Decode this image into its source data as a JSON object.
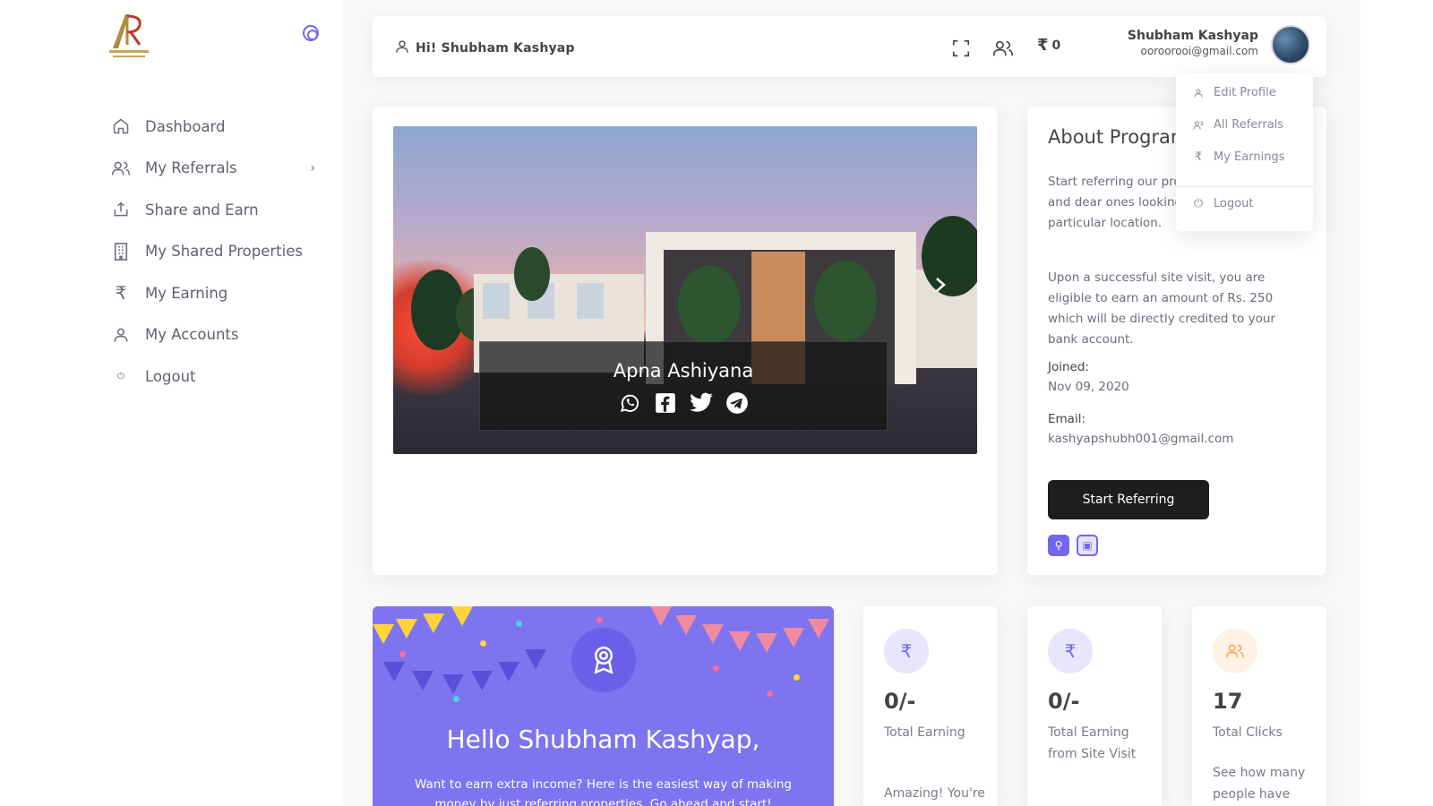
{
  "sidebar": {
    "items": [
      {
        "label": "Dashboard",
        "icon": "home-icon"
      },
      {
        "label": "My Referrals",
        "icon": "users-icon"
      },
      {
        "label": "Share and Earn",
        "icon": "share-icon"
      },
      {
        "label": "My Shared Properties",
        "icon": "building-icon"
      },
      {
        "label": "My Earning",
        "icon": "rupee-icon"
      },
      {
        "label": "My Accounts",
        "icon": "user-icon"
      },
      {
        "label": "Logout",
        "icon": "power-icon"
      }
    ]
  },
  "topbar": {
    "greeting": "Hi! Shubham Kashyap",
    "rupee_count": "0",
    "user_name": "Shubham Kashyap",
    "user_email": "ooroorooi@gmail.com"
  },
  "user_menu": {
    "items": [
      "Edit Profile",
      "All Referrals",
      "My Earnings",
      "Logout"
    ]
  },
  "banner": {
    "title": "Apna Ashiyana"
  },
  "about": {
    "title": "About Program",
    "para1": "Start referring our properties to your near and dear ones looking for property in a particular location.",
    "para2": "Upon a successful site visit, you are eligible to earn an amount of Rs. 250 which will be directly credited to your bank account.",
    "joined_label": "Joined:",
    "joined_value": "Nov 09, 2020",
    "email_label": "Email:",
    "email_value": "kashyapshubh001@gmail.com",
    "button_label": "Start Referring"
  },
  "hello": {
    "title": "Hello Shubham Kashyap,",
    "text": "Want to earn extra income? Here is the easiest way of making money by just referring properties. Go ahead and start!"
  },
  "stats": [
    {
      "value": "0/-",
      "label": "Total Earning",
      "desc": "Amazing! You're on track"
    },
    {
      "value": "0/-",
      "label": "Total Earning from Site Visit",
      "desc": ""
    },
    {
      "value": "17",
      "label": "Total Clicks",
      "desc": "See how many people have clicked"
    }
  ],
  "colors": {
    "primary": "#7367f0",
    "orange": "#ff9f43",
    "dark_button": "#1e1e1e"
  }
}
